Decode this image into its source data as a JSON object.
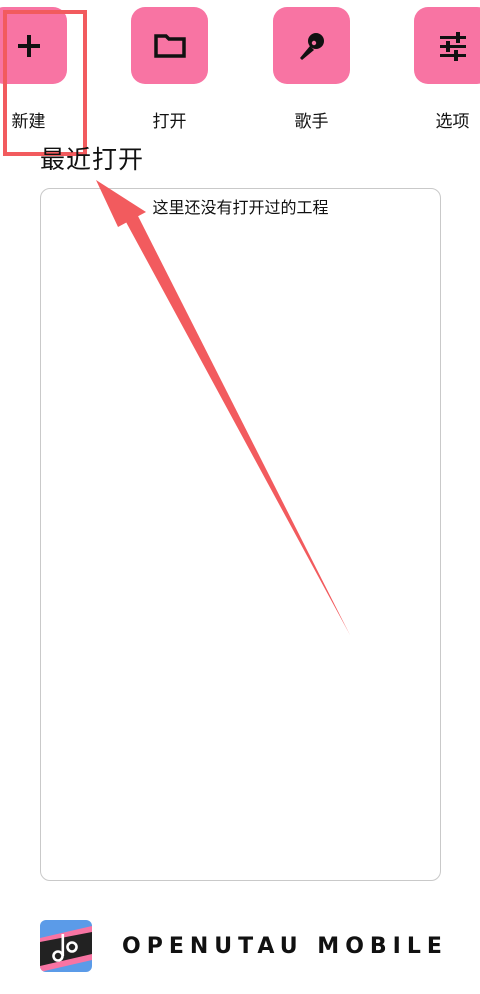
{
  "toolbar": {
    "new": {
      "label": "新建",
      "icon": "plus-icon"
    },
    "open": {
      "label": "打开",
      "icon": "folder-icon"
    },
    "singer": {
      "label": "歌手",
      "icon": "microphone-icon"
    },
    "options": {
      "label": "选项",
      "icon": "sliders-icon"
    }
  },
  "recent": {
    "title": "最近打开",
    "empty_message": "这里还没有打开过的工程"
  },
  "footer": {
    "brand": "OPENUTAU MOBILE",
    "logo_icon": "openutau-logo-icon"
  },
  "colors": {
    "accent": "#f874a3",
    "annotation": "#f25b5e"
  }
}
